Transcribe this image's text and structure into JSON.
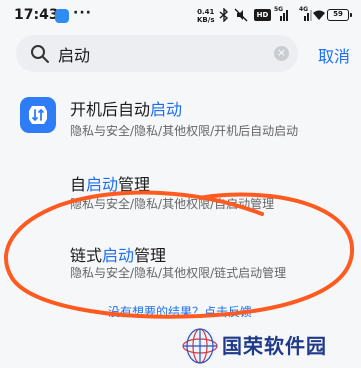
{
  "status_bar": {
    "time": "17:43",
    "more": "···",
    "net_speed_value": "0.41",
    "net_speed_unit": "KB/s",
    "hd_badge": "HD",
    "signal_1_label": "5G",
    "signal_2_label": "4G",
    "battery_level": "59"
  },
  "search": {
    "query": "启动",
    "cancel_label": "取消"
  },
  "results": [
    {
      "title_prefix": "开机后自动",
      "title_highlight": "启动",
      "title_suffix": "",
      "path": "隐私与安全/隐私/其他权限/开机后自动启动"
    },
    {
      "title_prefix": "自",
      "title_highlight": "启动",
      "title_suffix": "管理",
      "path": "隐私与安全/隐私/其他权限/自启动管理"
    },
    {
      "title_prefix": "链式",
      "title_highlight": "启动",
      "title_suffix": "管理",
      "path": "隐私与安全/隐私/其他权限/链式启动管理"
    }
  ],
  "feedback_link": "没有想要的结果？点击反馈",
  "watermark": {
    "text": "国荣软件园"
  },
  "colors": {
    "accent": "#1d6ff2",
    "scribble": "#ff5a1f"
  }
}
